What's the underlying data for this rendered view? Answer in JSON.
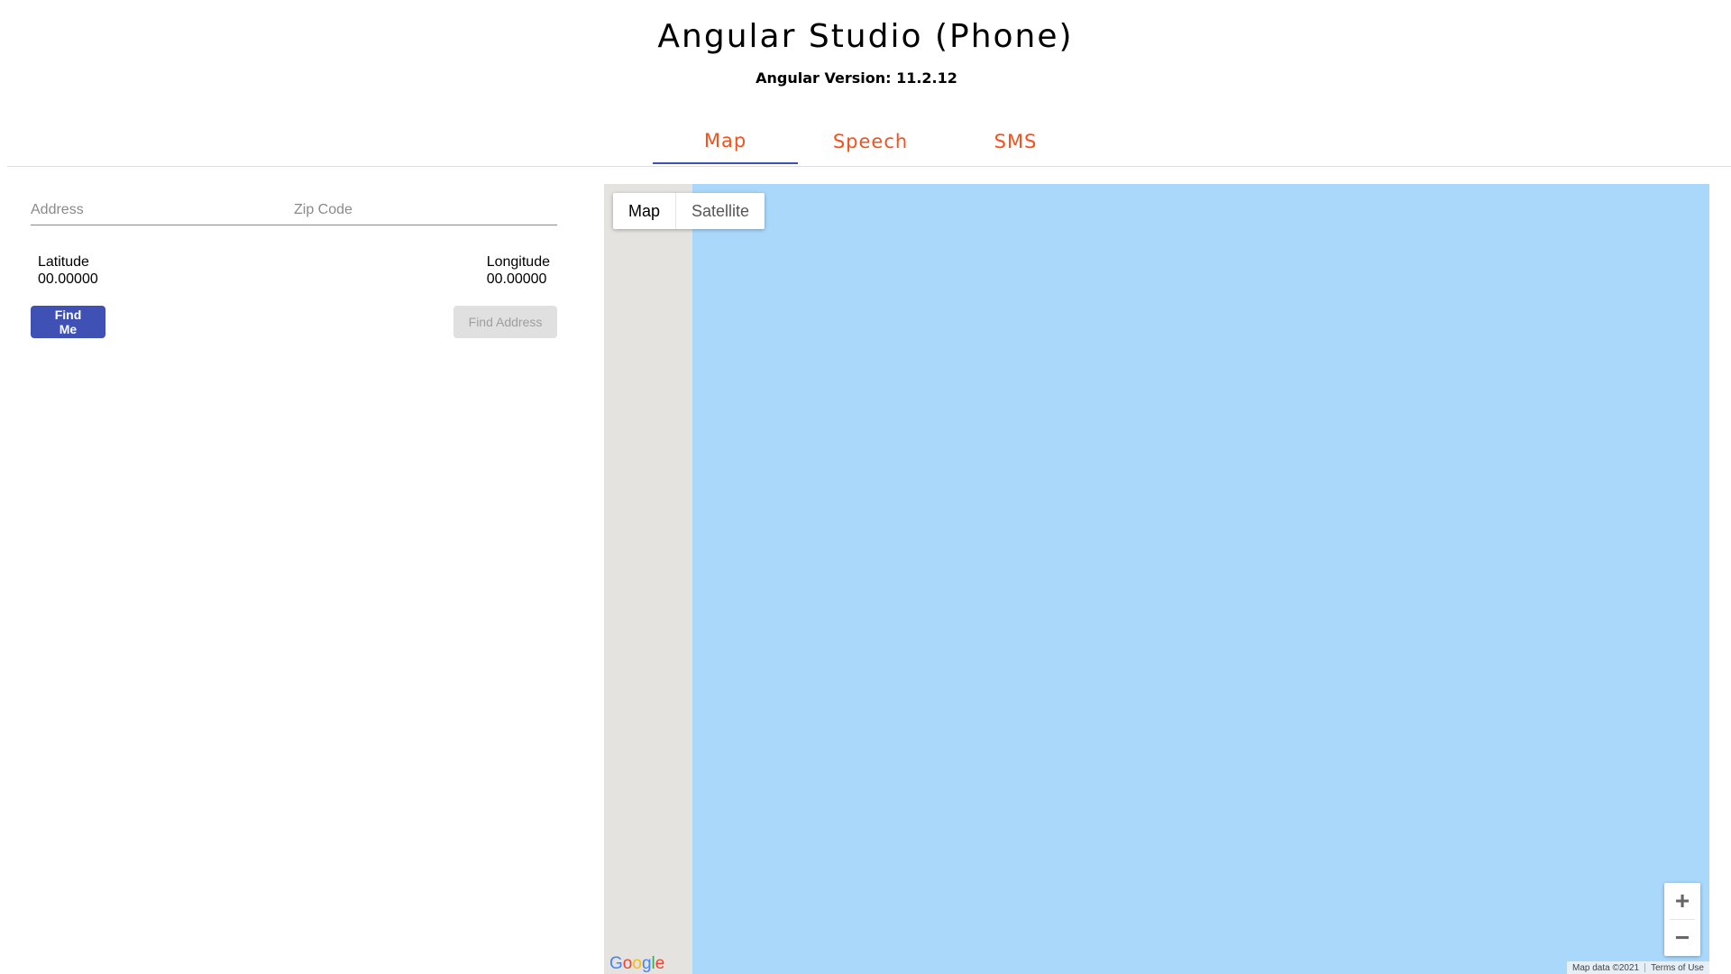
{
  "header": {
    "title": "Angular Studio (Phone)",
    "version": "Angular Version: 11.2.12"
  },
  "tabs": [
    {
      "label": "Map",
      "active": true
    },
    {
      "label": "Speech",
      "active": false
    },
    {
      "label": "SMS",
      "active": false
    }
  ],
  "form": {
    "address_placeholder": "Address",
    "zip_placeholder": "Zip Code",
    "latitude_label": "Latitude",
    "latitude_value": "00.00000",
    "longitude_label": "Longitude",
    "longitude_value": "00.00000",
    "find_me_label": "Find Me",
    "find_address_label": "Find Address"
  },
  "map": {
    "type_map": "Map",
    "type_satellite": "Satellite",
    "zoom_in": "+",
    "zoom_out": "−",
    "logo": [
      "G",
      "o",
      "o",
      "g",
      "l",
      "e"
    ],
    "map_data": "Map data ©2021",
    "terms": "Terms of Use",
    "water_color": "#aad8fb",
    "land_color": "#e5e3df"
  },
  "colors": {
    "accent": "#3f51b5",
    "tab_text": "#f4511e"
  }
}
